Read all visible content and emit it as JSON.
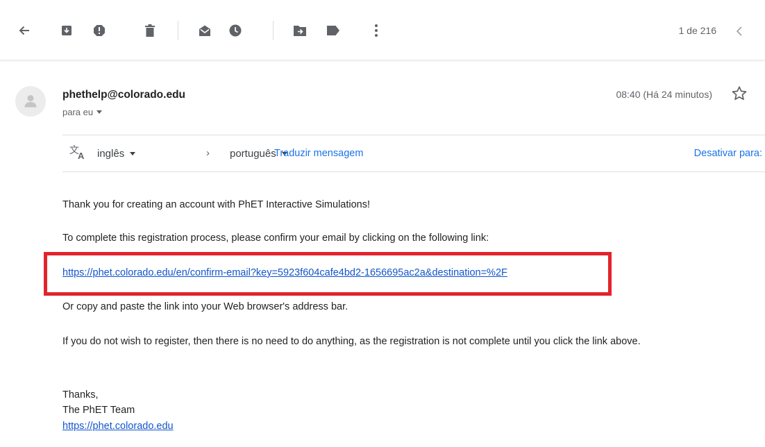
{
  "toolbar": {
    "icons": [
      "back-arrow-icon",
      "archive-icon",
      "report-spam-icon",
      "delete-icon",
      "mark-unread-icon",
      "snooze-icon",
      "move-to-icon",
      "label-icon",
      "more-vert-icon"
    ],
    "pager": "1 de 216"
  },
  "message": {
    "sender": "phethelp@colorado.edu",
    "recipient": "para eu",
    "timestamp": "08:40 (Há 24 minutos)"
  },
  "translate": {
    "source_lang": "inglês",
    "target_lang": "português",
    "translate_link": "Traduzir mensagem",
    "disable_link": "Desativar para:"
  },
  "email_body": {
    "line1": "Thank you for creating an account with PhET Interactive Simulations!",
    "line2": "To complete this registration process, please confirm your email by clicking on the following link:",
    "confirm_link": "https://phet.colorado.edu/en/confirm-email?key=5923f604cafe4bd2-1656695ac2a&destination=%2F",
    "line3": "Or copy and paste the link into your Web browser's address bar.",
    "line4": "If you do not wish to register, then there is no need to do anything, as the registration is not complete until you click the link above.",
    "signoff": "Thanks,",
    "team": "The PhET Team",
    "site_link": "https://phet.colorado.edu"
  },
  "colors": {
    "highlight": "#e3232c",
    "link": "#1155cc",
    "accent": "#1a73e8"
  }
}
